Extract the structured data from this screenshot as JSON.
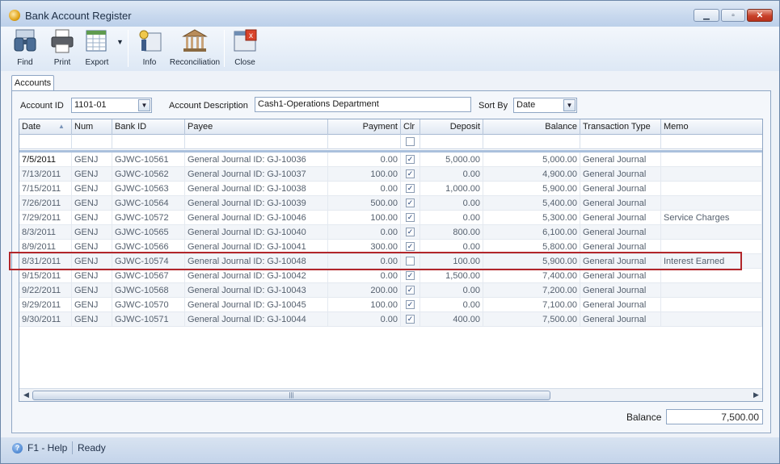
{
  "window": {
    "title": "Bank Account Register",
    "min_glyph": "▁",
    "max_glyph": "▫",
    "close_glyph": "✕"
  },
  "toolbar": {
    "items": [
      {
        "label": "Find",
        "icon": "binoculars-icon"
      },
      {
        "label": "Print",
        "icon": "printer-icon"
      },
      {
        "label": "Export",
        "icon": "export-spreadsheet-icon"
      },
      {
        "label": "Info",
        "icon": "info-icon"
      },
      {
        "label": "Reconciliation",
        "icon": "bank-building-icon"
      },
      {
        "label": "Close",
        "icon": "close-window-icon"
      }
    ]
  },
  "tab": {
    "label": "Accounts"
  },
  "filters": {
    "account_id_label": "Account ID",
    "account_id_value": "1101-01",
    "account_desc_label": "Account Description",
    "account_desc_value": "Cash1-Operations Department",
    "sort_by_label": "Sort By",
    "sort_by_value": "Date"
  },
  "grid": {
    "headers": [
      "Date",
      "Num",
      "Bank ID",
      "Payee",
      "Payment",
      "Clr",
      "Deposit",
      "Balance",
      "Transaction Type",
      "Memo"
    ],
    "rows": [
      {
        "date": "7/5/2011",
        "num": "GENJ",
        "bank_id": "GJWC-10561",
        "payee": "General Journal ID: GJ-10036",
        "payment": "0.00",
        "clr": true,
        "deposit": "5,000.00",
        "balance": "5,000.00",
        "type": "General Journal",
        "memo": ""
      },
      {
        "date": "7/13/2011",
        "num": "GENJ",
        "bank_id": "GJWC-10562",
        "payee": "General Journal ID: GJ-10037",
        "payment": "100.00",
        "clr": true,
        "deposit": "0.00",
        "balance": "4,900.00",
        "type": "General Journal",
        "memo": ""
      },
      {
        "date": "7/15/2011",
        "num": "GENJ",
        "bank_id": "GJWC-10563",
        "payee": "General Journal ID: GJ-10038",
        "payment": "0.00",
        "clr": true,
        "deposit": "1,000.00",
        "balance": "5,900.00",
        "type": "General Journal",
        "memo": ""
      },
      {
        "date": "7/26/2011",
        "num": "GENJ",
        "bank_id": "GJWC-10564",
        "payee": "General Journal ID: GJ-10039",
        "payment": "500.00",
        "clr": true,
        "deposit": "0.00",
        "balance": "5,400.00",
        "type": "General Journal",
        "memo": ""
      },
      {
        "date": "7/29/2011",
        "num": "GENJ",
        "bank_id": "GJWC-10572",
        "payee": "General Journal ID: GJ-10046",
        "payment": "100.00",
        "clr": true,
        "deposit": "0.00",
        "balance": "5,300.00",
        "type": "General Journal",
        "memo": "Service Charges"
      },
      {
        "date": "8/3/2011",
        "num": "GENJ",
        "bank_id": "GJWC-10565",
        "payee": "General Journal ID: GJ-10040",
        "payment": "0.00",
        "clr": true,
        "deposit": "800.00",
        "balance": "6,100.00",
        "type": "General Journal",
        "memo": ""
      },
      {
        "date": "8/9/2011",
        "num": "GENJ",
        "bank_id": "GJWC-10566",
        "payee": "General Journal ID: GJ-10041",
        "payment": "300.00",
        "clr": true,
        "deposit": "0.00",
        "balance": "5,800.00",
        "type": "General Journal",
        "memo": ""
      },
      {
        "date": "8/31/2011",
        "num": "GENJ",
        "bank_id": "GJWC-10574",
        "payee": "General Journal ID: GJ-10048",
        "payment": "0.00",
        "clr": false,
        "deposit": "100.00",
        "balance": "5,900.00",
        "type": "General Journal",
        "memo": "Interest Earned"
      },
      {
        "date": "9/15/2011",
        "num": "GENJ",
        "bank_id": "GJWC-10567",
        "payee": "General Journal ID: GJ-10042",
        "payment": "0.00",
        "clr": true,
        "deposit": "1,500.00",
        "balance": "7,400.00",
        "type": "General Journal",
        "memo": ""
      },
      {
        "date": "9/22/2011",
        "num": "GENJ",
        "bank_id": "GJWC-10568",
        "payee": "General Journal ID: GJ-10043",
        "payment": "200.00",
        "clr": true,
        "deposit": "0.00",
        "balance": "7,200.00",
        "type": "General Journal",
        "memo": ""
      },
      {
        "date": "9/29/2011",
        "num": "GENJ",
        "bank_id": "GJWC-10570",
        "payee": "General Journal ID: GJ-10045",
        "payment": "100.00",
        "clr": true,
        "deposit": "0.00",
        "balance": "7,100.00",
        "type": "General Journal",
        "memo": ""
      },
      {
        "date": "9/30/2011",
        "num": "GENJ",
        "bank_id": "GJWC-10571",
        "payee": "General Journal ID: GJ-10044",
        "payment": "0.00",
        "clr": true,
        "deposit": "400.00",
        "balance": "7,500.00",
        "type": "General Journal",
        "memo": ""
      }
    ],
    "highlighted_row": 7,
    "highlight_color": "#b2262a"
  },
  "footer": {
    "balance_label": "Balance",
    "balance_value": "7,500.00"
  },
  "status": {
    "help": "F1 - Help",
    "state": "Ready"
  }
}
